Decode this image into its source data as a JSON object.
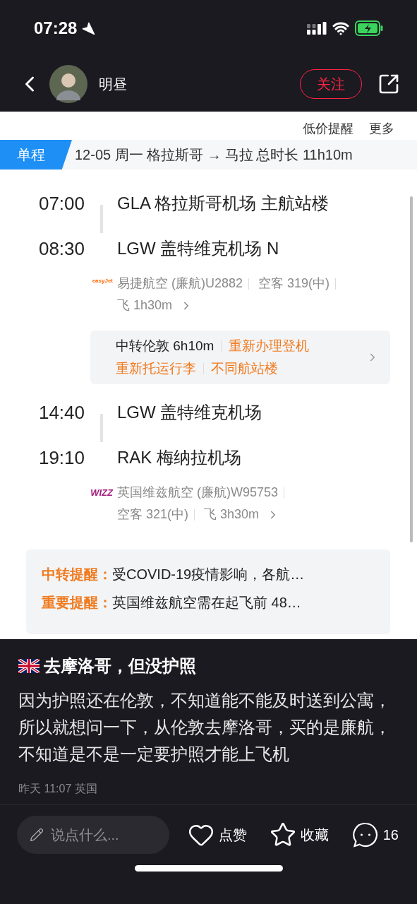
{
  "status_bar": {
    "time": "07:28"
  },
  "nav": {
    "user_name": "明昼",
    "follow_button": "关注"
  },
  "screenshot": {
    "header_links": [
      "低价提醒",
      "更多"
    ],
    "trip": {
      "tag": "单程",
      "route": "12-05 周一  格拉斯哥 → 马拉",
      "duration": "总时长 11h10m"
    },
    "segments": [
      {
        "kind": "flight",
        "dep_time": "07:00",
        "dep_airport": "GLA 格拉斯哥机场 主航站楼",
        "arr_time": "08:30",
        "arr_airport": "LGW 盖特维克机场 N",
        "color": "#ff6600",
        "logo": "easyJet",
        "details": [
          "易捷航空 (廉航)U2882",
          "空客 319(中)",
          "飞 1h30m"
        ]
      },
      {
        "kind": "transfer",
        "text": "中转伦敦 6h10m",
        "tags": [
          "重新办理登机",
          "重新托运行李",
          "不同航站楼"
        ]
      },
      {
        "kind": "flight",
        "dep_time": "14:40",
        "dep_airport": "LGW 盖特维克机场",
        "arr_time": "19:10",
        "arr_airport": "RAK 梅纳拉机场",
        "color": "#a3207e",
        "logo": "WIZZ",
        "details": [
          "英国维兹航空 (廉航)W95753",
          "空客 321(中)",
          "飞 3h30m"
        ]
      }
    ],
    "notices": [
      {
        "label": "中转提醒：",
        "text": "受COVID-19疫情影响，各航…"
      },
      {
        "label": "重要提醒：",
        "text": "英国维兹航空需在起飞前 48…"
      }
    ]
  },
  "post": {
    "title": "去摩洛哥，但没护照",
    "body": "因为护照还在伦敦，不知道能不能及时送到公寓，所以就想问一下，从伦敦去摩洛哥，买的是廉航，不知道是不是一定要护照才能上飞机",
    "meta": "昨天 11:07 英国"
  },
  "bottom_bar": {
    "comment_placeholder": "说点什么...",
    "actions": [
      {
        "kind": "like",
        "label": "点赞"
      },
      {
        "kind": "favorite",
        "label": "收藏"
      },
      {
        "kind": "comment",
        "label": "16"
      }
    ]
  }
}
